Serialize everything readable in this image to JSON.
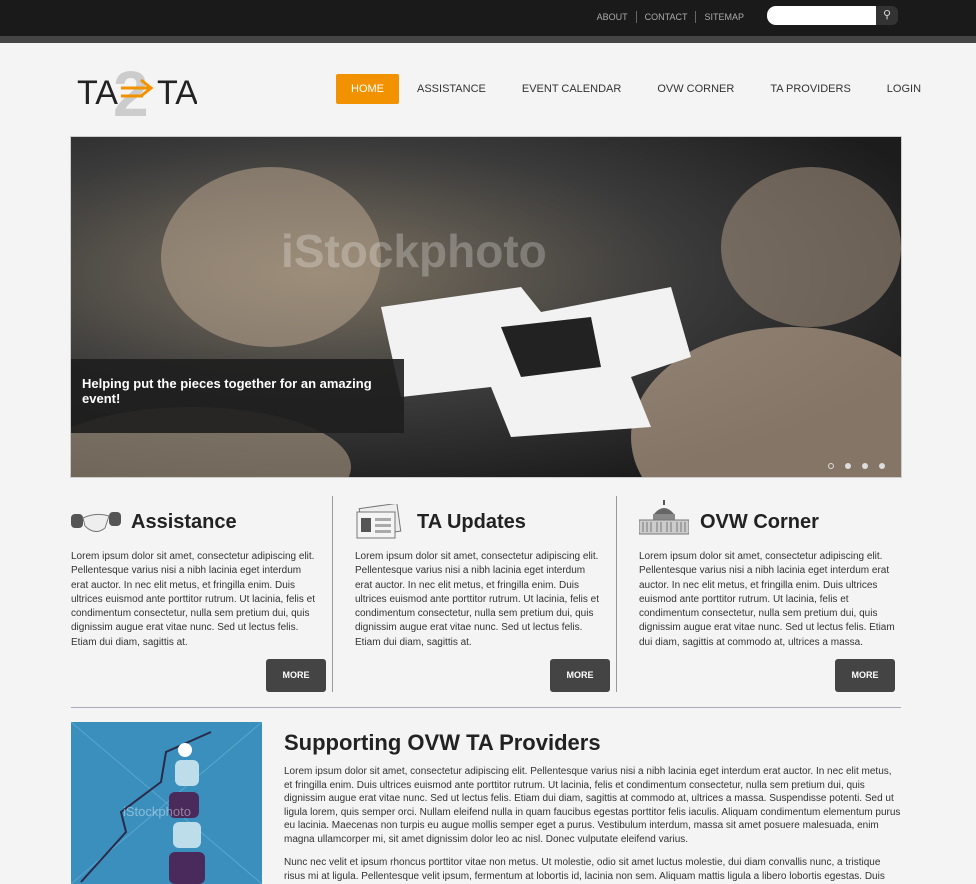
{
  "topbar": {
    "links": [
      "ABOUT",
      "CONTACT",
      "SITEMAP"
    ],
    "search_placeholder": ""
  },
  "logo": {
    "text": "TA2TA"
  },
  "nav": {
    "items": [
      "HOME",
      "ASSISTANCE",
      "EVENT CALENDAR",
      "OVW CORNER",
      "TA PROVIDERS",
      "LOGIN"
    ],
    "active": "HOME",
    "accent": "#f39200"
  },
  "hero": {
    "caption": "Helping put the pieces together for an amazing event!",
    "watermark": "iStockphoto",
    "slides": 4,
    "current_slide": 1
  },
  "columns": [
    {
      "title": "Assistance",
      "icon": "handshake-icon",
      "text": "Lorem ipsum dolor sit amet, consectetur adipiscing elit. Pellentesque varius nisi a nibh lacinia eget interdum erat auctor. In nec elit metus, et fringilla enim. Duis ultrices euismod ante porttitor rutrum. Ut lacinia, felis et condimentum consectetur, nulla sem pretium dui, quis dignissim augue erat vitae nunc. Sed ut lectus felis. Etiam dui diam, sagittis at.",
      "button": "MORE"
    },
    {
      "title": "TA Updates",
      "icon": "newspaper-icon",
      "text": "Lorem ipsum dolor sit amet, consectetur adipiscing elit. Pellentesque varius nisi a nibh lacinia eget interdum erat auctor. In nec elit metus, et fringilla enim. Duis ultrices euismod ante porttitor rutrum. Ut lacinia, felis et condimentum consectetur, nulla sem pretium dui, quis dignissim augue erat vitae nunc. Sed ut lectus felis. Etiam dui diam, sagittis at.",
      "button": "MORE"
    },
    {
      "title": "OVW Corner",
      "icon": "capitol-icon",
      "text": "Lorem ipsum dolor sit amet, consectetur adipiscing elit. Pellentesque varius nisi a nibh lacinia eget interdum erat auctor. In nec elit metus, et fringilla enim. Duis ultrices euismod ante porttitor rutrum. Ut lacinia, felis et condimentum consectetur, nulla sem pretium dui, quis dignissim augue erat vitae nunc. Sed ut lectus felis. Etiam dui diam, sagittis at commodo at, ultrices a massa.",
      "button": "MORE"
    }
  ],
  "bottom": {
    "title": "Supporting OVW TA Providers",
    "image_watermark": "iStockphoto",
    "paragraphs": [
      "Lorem ipsum dolor sit amet, consectetur adipiscing elit. Pellentesque varius nisi a nibh lacinia eget interdum erat auctor. In nec elit metus, et fringilla enim. Duis ultrices euismod ante porttitor rutrum. Ut lacinia, felis et condimentum consectetur, nulla sem pretium dui, quis dignissim augue erat vitae nunc. Sed ut lectus felis. Etiam dui diam, sagittis at commodo at, ultrices a massa. Suspendisse potenti. Sed ut ligula lorem, quis semper orci. Nullam eleifend nulla in quam faucibus egestas porttitor felis iaculis. Aliquam condimentum elementum purus eu lacinia. Maecenas non turpis eu augue mollis semper eget a purus. Vestibulum interdum, massa sit amet posuere malesuada, enim magna ullamcorper mi, sit amet dignissim dolor leo ac nisl. Donec vulputate eleifend varius.",
      "Nunc nec velit et ipsum rhoncus porttitor vitae non metus. Ut molestie, odio sit amet luctus molestie, dui diam convallis nunc, a tristique risus mi at ligula. Pellentesque velit ipsum, fermentum at lobortis id, lacinia non sem. Aliquam mattis ligula a libero lobortis egestas. Duis"
    ]
  }
}
